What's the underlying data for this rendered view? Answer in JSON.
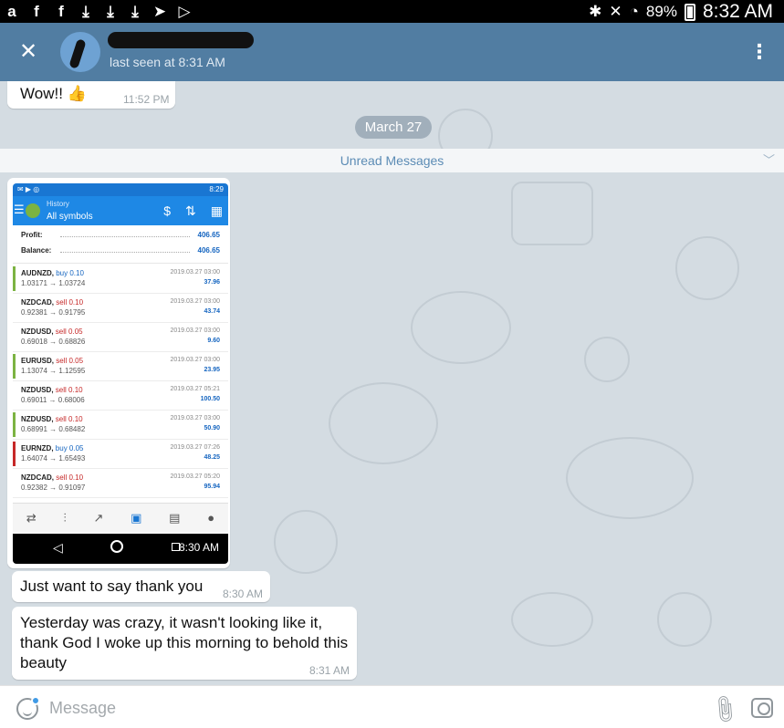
{
  "status_bar": {
    "left_icons": [
      "a-icon",
      "facebook-icon",
      "facebook-icon",
      "download-icon",
      "download-icon",
      "download-icon",
      "telegram-icon",
      "play-icon"
    ],
    "battery": "89%",
    "time": "8:32 AM"
  },
  "header": {
    "last_seen": "last seen at 8:31 AM"
  },
  "messages": [
    {
      "text": "Wow!! 👍",
      "time": "11:52 PM"
    },
    {
      "text": "Just want to say thank you",
      "time": "8:30 AM"
    },
    {
      "text": "Yesterday was crazy, it wasn't looking like it, thank God I woke up this morning to behold this beauty",
      "time": "8:31 AM"
    }
  ],
  "date_divider": "March 27",
  "unread_label": "Unread Messages",
  "screenshot": {
    "status_time": "8:29",
    "subtitle": "History",
    "title": "All symbols",
    "profit_label": "Profit:",
    "profit_value": "406.65",
    "balance_label": "Balance:",
    "balance_value": "406.65",
    "trades": [
      {
        "symbol": "AUDNZD,",
        "side": "buy 0.10",
        "prices": "1.03171 → 1.03724",
        "date": "2019.03.27 03:00",
        "profit": "37.96",
        "color": "#7cb342",
        "side_color": "#1565c0"
      },
      {
        "symbol": "NZDCAD,",
        "side": "sell 0.10",
        "prices": "0.92381 → 0.91795",
        "date": "2019.03.27 03:00",
        "profit": "43.74",
        "color": "#ffffff",
        "side_color": "#c62828"
      },
      {
        "symbol": "NZDUSD,",
        "side": "sell 0.05",
        "prices": "0.69018 → 0.68826",
        "date": "2019.03.27 03:00",
        "profit": "9.60",
        "color": "#ffffff",
        "side_color": "#c62828"
      },
      {
        "symbol": "EURUSD,",
        "side": "sell 0.05",
        "prices": "1.13074 → 1.12595",
        "date": "2019.03.27 03:00",
        "profit": "23.95",
        "color": "#7cb342",
        "side_color": "#c62828"
      },
      {
        "symbol": "NZDUSD,",
        "side": "sell 0.10",
        "prices": "0.69011 → 0.68006",
        "date": "2019.03.27 05:21",
        "profit": "100.50",
        "color": "#ffffff",
        "side_color": "#c62828"
      },
      {
        "symbol": "NZDUSD,",
        "side": "sell 0.10",
        "prices": "0.68991 → 0.68482",
        "date": "2019.03.27 03:00",
        "profit": "50.90",
        "color": "#7cb342",
        "side_color": "#c62828"
      },
      {
        "symbol": "EURNZD,",
        "side": "buy 0.05",
        "prices": "1.64074 → 1.65493",
        "date": "2019.03.27 07:26",
        "profit": "48.25",
        "color": "#c62828",
        "side_color": "#1565c0"
      },
      {
        "symbol": "NZDCAD,",
        "side": "sell 0.10",
        "prices": "0.92382 → 0.91097",
        "date": "2019.03.27 05:20",
        "profit": "95.94",
        "color": "#ffffff",
        "side_color": "#c62828"
      }
    ],
    "nav_time": "8:30 AM"
  },
  "composer": {
    "placeholder": "Message"
  }
}
